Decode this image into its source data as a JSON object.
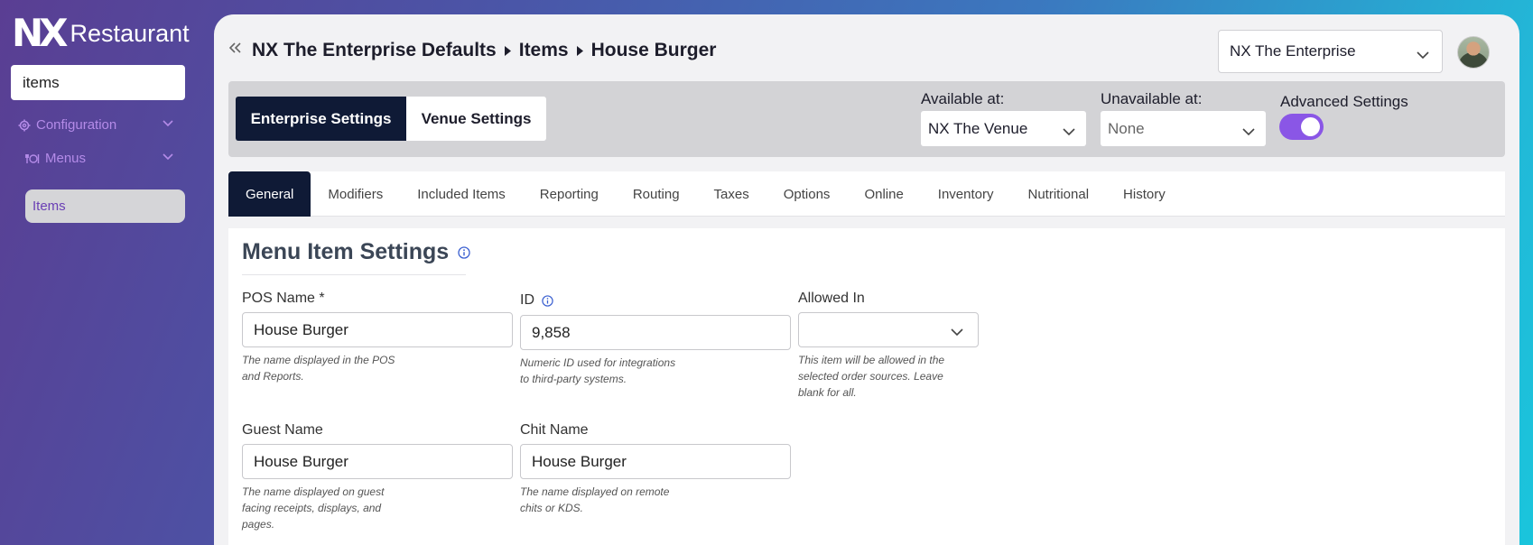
{
  "sidebar": {
    "logo_mark": "NX",
    "logo_text": "Restaurant",
    "search_value": "items",
    "groups": [
      {
        "label": "Configuration",
        "icon": "gear-icon"
      },
      {
        "label": "Menus",
        "icon": "utensils-icon"
      }
    ],
    "active_item": "Items"
  },
  "header": {
    "breadcrumb": [
      "NX The Enterprise Defaults",
      "Items",
      "House Burger"
    ],
    "enterprise_select": "NX The Enterprise"
  },
  "settings_bar": {
    "enterprise_button": "Enterprise Settings",
    "venue_button": "Venue Settings",
    "available_label": "Available at:",
    "available_value": "NX The Venue",
    "unavailable_label": "Unavailable at:",
    "unavailable_value": "None",
    "advanced_label": "Advanced Settings",
    "advanced_enabled": true
  },
  "tabs": [
    "General",
    "Modifiers",
    "Included Items",
    "Reporting",
    "Routing",
    "Taxes",
    "Options",
    "Online",
    "Inventory",
    "Nutritional",
    "History"
  ],
  "active_tab": "General",
  "form": {
    "title": "Menu Item Settings",
    "pos_name": {
      "label": "POS Name *",
      "value": "House Burger",
      "help": "The name displayed in the POS and Reports."
    },
    "id": {
      "label": "ID",
      "value": "9,858",
      "help": "Numeric ID used for integrations to third-party systems."
    },
    "allowed_in": {
      "label": "Allowed In",
      "value": "",
      "help": "This item will be allowed in the selected order sources. Leave blank for all."
    },
    "guest_name": {
      "label": "Guest Name",
      "value": "House Burger",
      "help": "The name displayed on guest facing receipts, displays, and pages."
    },
    "chit_name": {
      "label": "Chit Name",
      "value": "House Burger",
      "help": "The name displayed on remote chits or KDS."
    }
  },
  "colors": {
    "accent_purple": "#8a56e6",
    "navy": "#0f1a36"
  }
}
